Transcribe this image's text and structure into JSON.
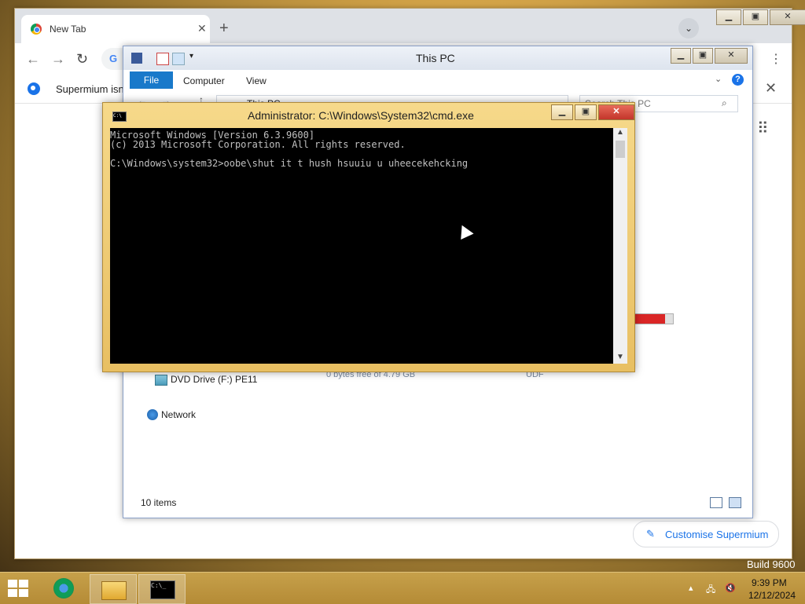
{
  "browser": {
    "tab_title": "New Tab",
    "tab_close": "✕",
    "new_tab": "+",
    "dropdown": "⌄",
    "infobar_text": "Supermium isn",
    "infobar_close": "✕",
    "customise_label": "Customise Supermium",
    "omnibox_letter": "G"
  },
  "explorer": {
    "title": "This PC",
    "ribbon": {
      "file": "File",
      "computer": "Computer",
      "view": "View"
    },
    "address": "This PC",
    "search_placeholder": "Search This PC",
    "drive": {
      "name": "DVD Drive (F:) PE11",
      "free": "0 bytes free of 4.79 GB",
      "fs": "UDF"
    },
    "network": "Network",
    "status": "10 items"
  },
  "cmd": {
    "title": "Administrator: C:\\Windows\\System32\\cmd.exe",
    "lines": [
      "Microsoft Windows [Version 6.3.9600]",
      "(c) 2013 Microsoft Corporation. All rights reserved.",
      "",
      "C:\\Windows\\system32>oobe\\shut it t hush hsuuiu u uheecekehcking"
    ]
  },
  "taskbar": {
    "time": "9:39 PM",
    "date": "12/12/2024"
  },
  "desktop": {
    "build": "Build 9600"
  }
}
